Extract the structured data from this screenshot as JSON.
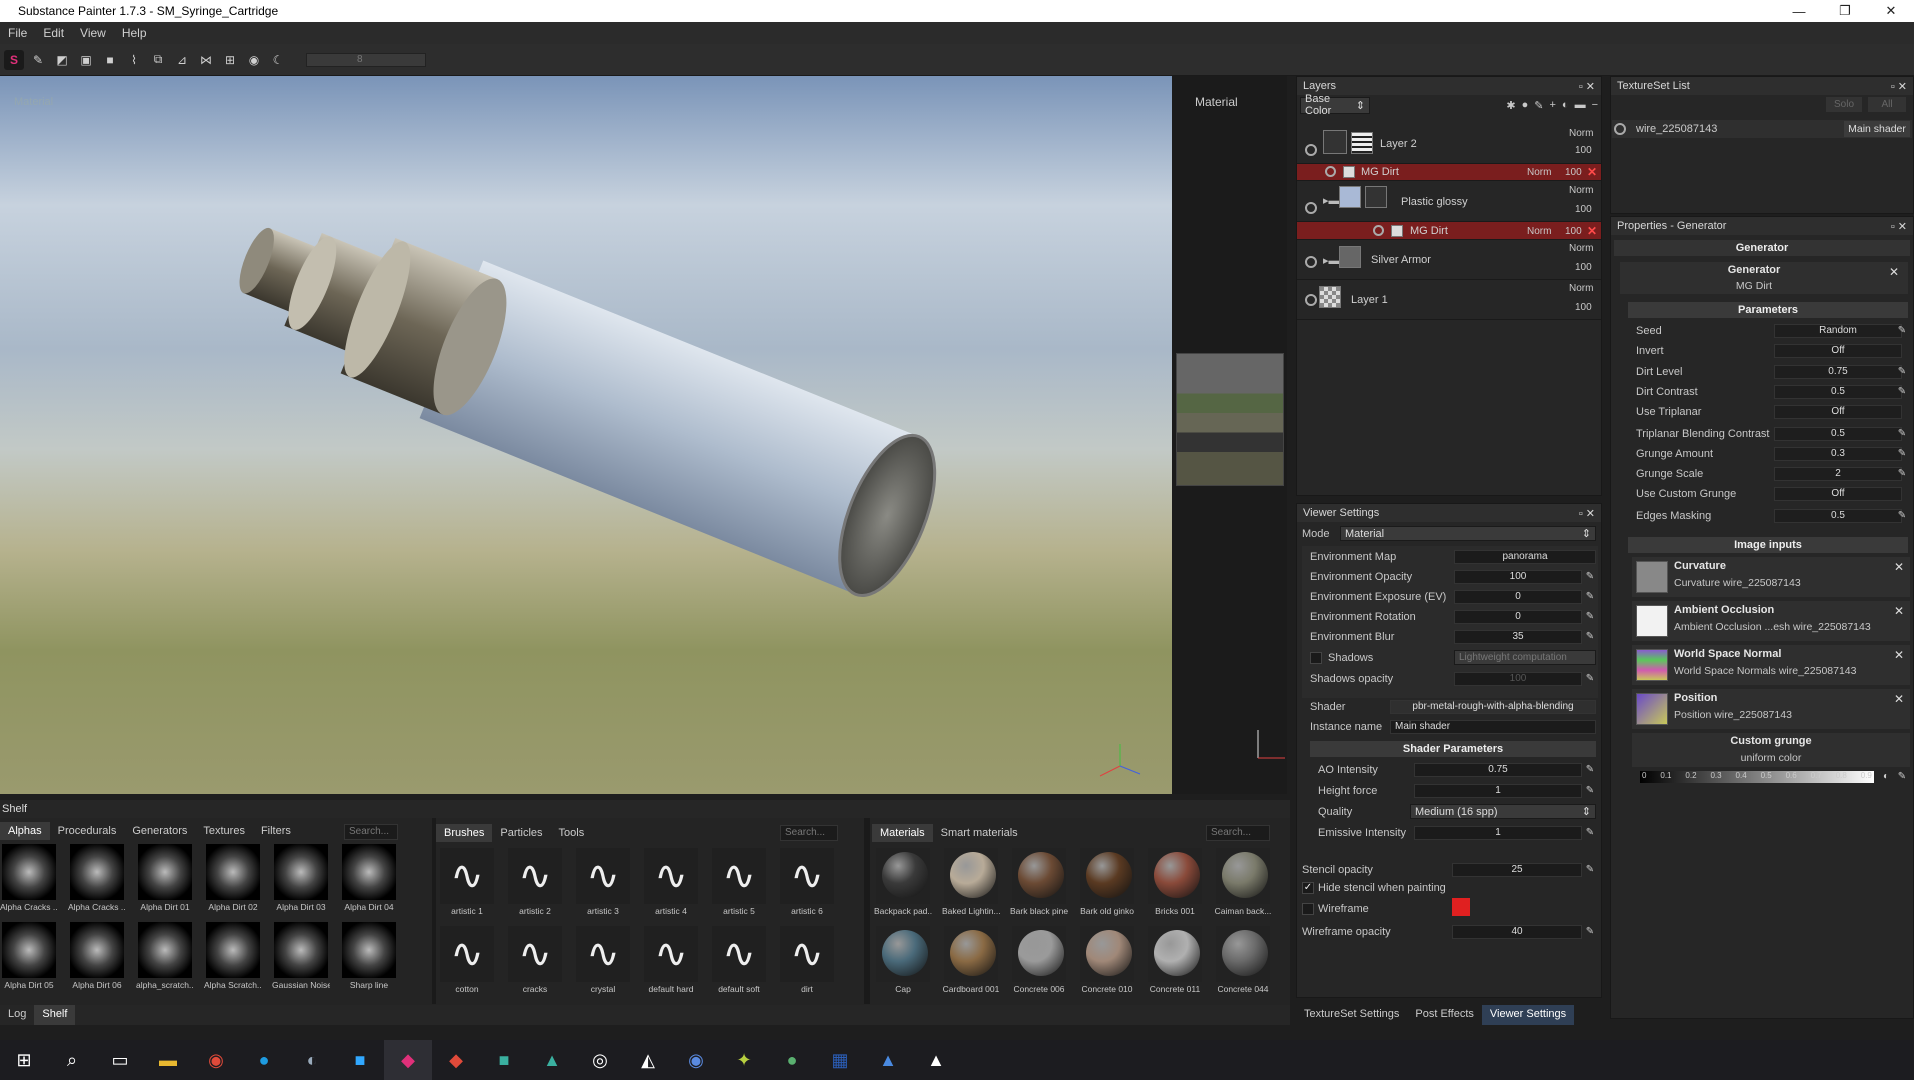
{
  "window": {
    "title": "Substance Painter 1.7.3 - SM_Syringe_Cartridge",
    "controls": [
      "—",
      "❐",
      "✕"
    ]
  },
  "menu": [
    "File",
    "Edit",
    "View",
    "Help"
  ],
  "toolbar": {
    "icons": [
      "logo-icon",
      "brush-icon",
      "eraser-icon",
      "projection-icon",
      "polygon-fill-icon",
      "smudge-icon",
      "clone-icon",
      "picker-icon",
      "symmetry-icon",
      "grid-icon",
      "camera-icon",
      "render-icon"
    ],
    "slider_value": "8"
  },
  "viewport": {
    "label": "Material",
    "uv_label": "Material"
  },
  "layers": {
    "title": "Layers",
    "channel": "Base Color",
    "rows": [
      {
        "name": "Layer 2",
        "blend": "Norm",
        "opacity": "100"
      },
      {
        "name": "MG Dirt",
        "blend": "Norm",
        "opacity": "100",
        "mask": true
      },
      {
        "name": "Plastic glossy",
        "blend": "Norm",
        "opacity": "100"
      },
      {
        "name": "MG Dirt",
        "blend": "Norm",
        "opacity": "100",
        "mask": true
      },
      {
        "name": "Silver Armor",
        "blend": "Norm",
        "opacity": "100"
      },
      {
        "name": "Layer 1",
        "blend": "Norm",
        "opacity": "100"
      }
    ]
  },
  "viewer": {
    "title": "Viewer Settings",
    "mode_label": "Mode",
    "mode": "Material",
    "rows": [
      {
        "label": "Environment Map",
        "value": "panorama"
      },
      {
        "label": "Environment Opacity",
        "value": "100",
        "fill": 1.0
      },
      {
        "label": "Environment Exposure (EV)",
        "value": "0",
        "fill": 0.5
      },
      {
        "label": "Environment Rotation",
        "value": "0",
        "fill": 0.0
      },
      {
        "label": "Environment Blur",
        "value": "35",
        "fill": 0.35
      }
    ],
    "shadows_label": "Shadows",
    "shadows_value": "Lightweight computation",
    "shadows_opacity_label": "Shadows opacity",
    "shadows_opacity": "100",
    "shader_label": "Shader",
    "shader": "pbr-metal-rough-with-alpha-blending",
    "instance_label": "Instance name",
    "instance": "Main shader",
    "shader_params": "Shader Parameters",
    "params": [
      {
        "label": "AO Intensity",
        "value": "0.75",
        "fill": 0.75
      },
      {
        "label": "Height force",
        "value": "1",
        "fill": 0.1
      },
      {
        "label": "Quality",
        "value": "Medium (16 spp)"
      },
      {
        "label": "Emissive Intensity",
        "value": "1",
        "fill": 0.1
      }
    ],
    "stencil_label": "Stencil opacity",
    "stencil": "25",
    "hide_stencil": "Hide stencil when painting",
    "wireframe_label": "Wireframe",
    "wireframe_color": "#e02020",
    "wire_opacity_label": "Wireframe opacity",
    "wire_opacity": "40"
  },
  "texlist": {
    "title": "TextureSet List",
    "solo": "Solo",
    "all": "All",
    "item": "wire_225087143",
    "shader": "Main shader"
  },
  "props": {
    "title": "Properties - Generator",
    "section": "Generator",
    "gen_label": "Generator",
    "gen_value": "MG Dirt",
    "parameters": "Parameters",
    "params": [
      {
        "label": "Seed",
        "value": "Random"
      },
      {
        "label": "Invert",
        "value": "Off"
      },
      {
        "label": "Dirt Level",
        "value": "0.75"
      },
      {
        "label": "Dirt Contrast",
        "value": "0.5"
      },
      {
        "label": "Use Triplanar",
        "value": "Off"
      },
      {
        "label": "Triplanar Blending Contrast",
        "value": "0.5"
      },
      {
        "label": "Grunge Amount",
        "value": "0.3"
      },
      {
        "label": "Grunge Scale",
        "value": "2"
      },
      {
        "label": "Use Custom Grunge",
        "value": "Off"
      },
      {
        "label": "Edges Masking",
        "value": "0.5"
      }
    ],
    "image_inputs": "Image inputs",
    "inputs": [
      {
        "name": "Curvature",
        "file": "Curvature wire_225087143"
      },
      {
        "name": "Ambient Occlusion",
        "file": "Ambient Occlusion ...esh wire_225087143"
      },
      {
        "name": "World Space Normal",
        "file": "World Space Normals wire_225087143"
      },
      {
        "name": "Position",
        "file": "Position wire_225087143"
      }
    ],
    "custom_grunge": "Custom grunge",
    "custom_grunge_value": "uniform color",
    "ramp": [
      "0",
      "0.1",
      "0.2",
      "0.3",
      "0.4",
      "0.5",
      "0.6",
      "0.7",
      "0.8",
      "0.9"
    ]
  },
  "shelf": {
    "title": "Shelf",
    "tabs1": [
      "Alphas",
      "Procedurals",
      "Generators",
      "Textures",
      "Filters"
    ],
    "tabs2": [
      "Brushes",
      "Particles",
      "Tools"
    ],
    "tabs3": [
      "Materials",
      "Smart materials"
    ],
    "search": "Search...",
    "alphas": [
      "Alpha Cracks ...",
      "Alpha Cracks ...",
      "Alpha Dirt 01",
      "Alpha Dirt 02",
      "Alpha Dirt 03",
      "Alpha Dirt 04",
      "Alpha Dirt 05",
      "Alpha Dirt 06",
      "alpha_scratch...",
      "Alpha Scratch...",
      "Gaussian Noise",
      "Sharp line"
    ],
    "brushes": [
      "artistic 1",
      "artistic 2",
      "artistic 3",
      "artistic 4",
      "artistic 5",
      "artistic 6",
      "cotton",
      "cracks",
      "crystal",
      "default hard",
      "default soft",
      "dirt"
    ],
    "materials": [
      "Backpack pad...",
      "Baked Lightin...",
      "Bark black pine",
      "Bark old ginko",
      "Bricks 001",
      "Caiman back...",
      "Cap",
      "Cardboard 001",
      "Concrete 006",
      "Concrete 010",
      "Concrete 011",
      "Concrete 044"
    ],
    "material_colors": [
      "#3a3a3a",
      "#b8ab98",
      "#6b4a34",
      "#5a3a22",
      "#8a4a3a",
      "#7a7a6a",
      "#4a6a7a",
      "#8a6a44",
      "#9a9a9a",
      "#a08878",
      "#b0b0b0",
      "#6a6a6a"
    ]
  },
  "bottom_left_tabs": [
    "Log",
    "Shelf"
  ],
  "bottom_right_tabs": [
    "TextureSet Settings",
    "Post Effects",
    "Viewer Settings"
  ],
  "taskbar": [
    "windows-icon",
    "search-icon",
    "task-view-icon",
    "explorer-icon",
    "chrome-icon",
    "skype-icon",
    "steam-icon",
    "photoshop-icon",
    "substance-icon",
    "substance-s-icon",
    "app-icon",
    "designer-icon",
    "unreal-icon",
    "unity-icon",
    "blender-icon",
    "marmoset-icon",
    "app2-icon",
    "word-icon",
    "app3-icon",
    "photos-icon"
  ]
}
